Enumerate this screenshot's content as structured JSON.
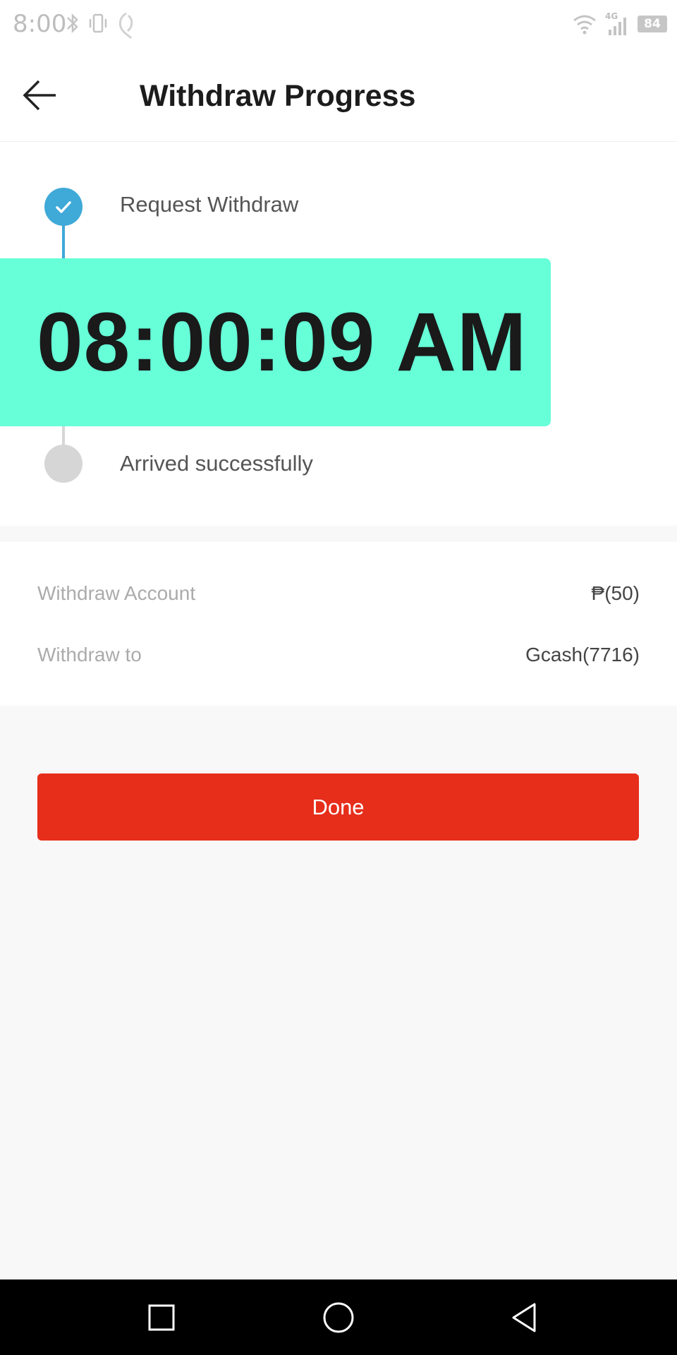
{
  "status_bar": {
    "time": "8:00",
    "battery": "84",
    "network": "4G",
    "left_icons": [
      "bluetooth-icon",
      "vibrate-icon",
      "notification-icon"
    ],
    "right_icons": [
      "wifi-icon",
      "signal-icon",
      "battery-icon"
    ]
  },
  "header": {
    "title": "Withdraw Progress",
    "back_icon": "arrow-left-icon"
  },
  "progress": {
    "steps": [
      {
        "label": "Request Withdraw",
        "status": "done"
      },
      {
        "label": "Arrived successfully",
        "status": "pending"
      }
    ],
    "time_overlay": "08:00:09 AM",
    "colors": {
      "done": "#3fa9d8",
      "pending": "#d6d6d6",
      "overlay": "#66ffd8"
    }
  },
  "details": {
    "rows": [
      {
        "label": "Withdraw Account",
        "value": "₱(50)"
      },
      {
        "label": "Withdraw to",
        "value": "Gcash(7716)"
      }
    ]
  },
  "actions": {
    "done_label": "Done",
    "done_color": "#e62e1b"
  },
  "nav_bar": {
    "icons": [
      "recents-square-icon",
      "home-circle-icon",
      "back-triangle-icon"
    ]
  }
}
